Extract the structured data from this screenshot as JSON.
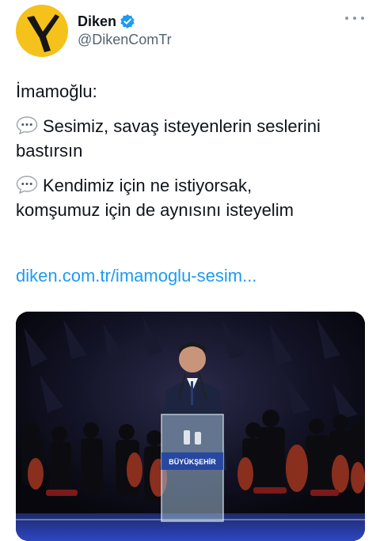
{
  "account": {
    "display_name": "Diken",
    "handle": "@DikenComTr",
    "verified": true,
    "avatar_icon": "diken-logo-icon",
    "avatar_color": "#f5c21b"
  },
  "menu": {
    "icon": "more-options-icon"
  },
  "tweet": {
    "title": "İmamoğlu:",
    "quotes": [
      {
        "icon": "speech-bubble-icon",
        "lines": [
          "Sesimiz, savaş isteyenlerin seslerini",
          "bastırsın"
        ]
      },
      {
        "icon": "speech-bubble-icon",
        "lines": [
          "Kendimiz için ne istiyorsak,",
          "komşumuz için de aynısını isteyelim"
        ]
      }
    ],
    "link": "diken.com.tr/imamoglu-sesim..."
  },
  "media": {
    "podium_text": "BÜYÜKŞEHİR"
  },
  "colors": {
    "link": "#1d9bf0",
    "verified": "#1d9bf0",
    "text": "#0f1419",
    "secondary": "#536471"
  }
}
